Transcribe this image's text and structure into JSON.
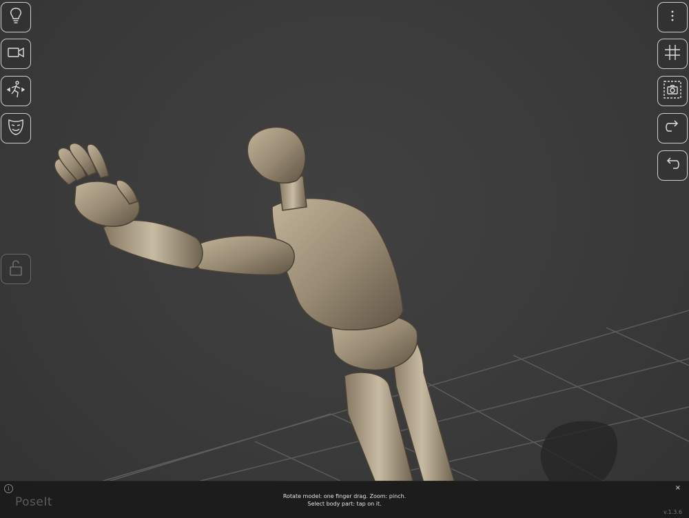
{
  "app": {
    "brand": "PoseIt",
    "version": "v.1.3.6"
  },
  "hint": {
    "line1": "Rotate model: one finger drag.  Zoom: pinch.",
    "line2": "Select body part: tap on it."
  },
  "info_glyph": "i",
  "close_glyph": "×",
  "left_toolbar": [
    {
      "name": "lightbulb-icon"
    },
    {
      "name": "video-camera-icon"
    },
    {
      "name": "pose-figure-icon"
    },
    {
      "name": "mask-icon"
    }
  ],
  "right_toolbar": [
    {
      "name": "more-vertical-icon"
    },
    {
      "name": "grid-icon"
    },
    {
      "name": "screenshot-camera-icon"
    },
    {
      "name": "redo-icon"
    },
    {
      "name": "undo-icon"
    }
  ],
  "lock": {
    "name": "unlock-icon",
    "state": "unlocked"
  },
  "colors": {
    "background": "#3a3a3a",
    "bar": "#1c1c1c",
    "model": "#a89a82",
    "icon": "#e0e0e0"
  }
}
